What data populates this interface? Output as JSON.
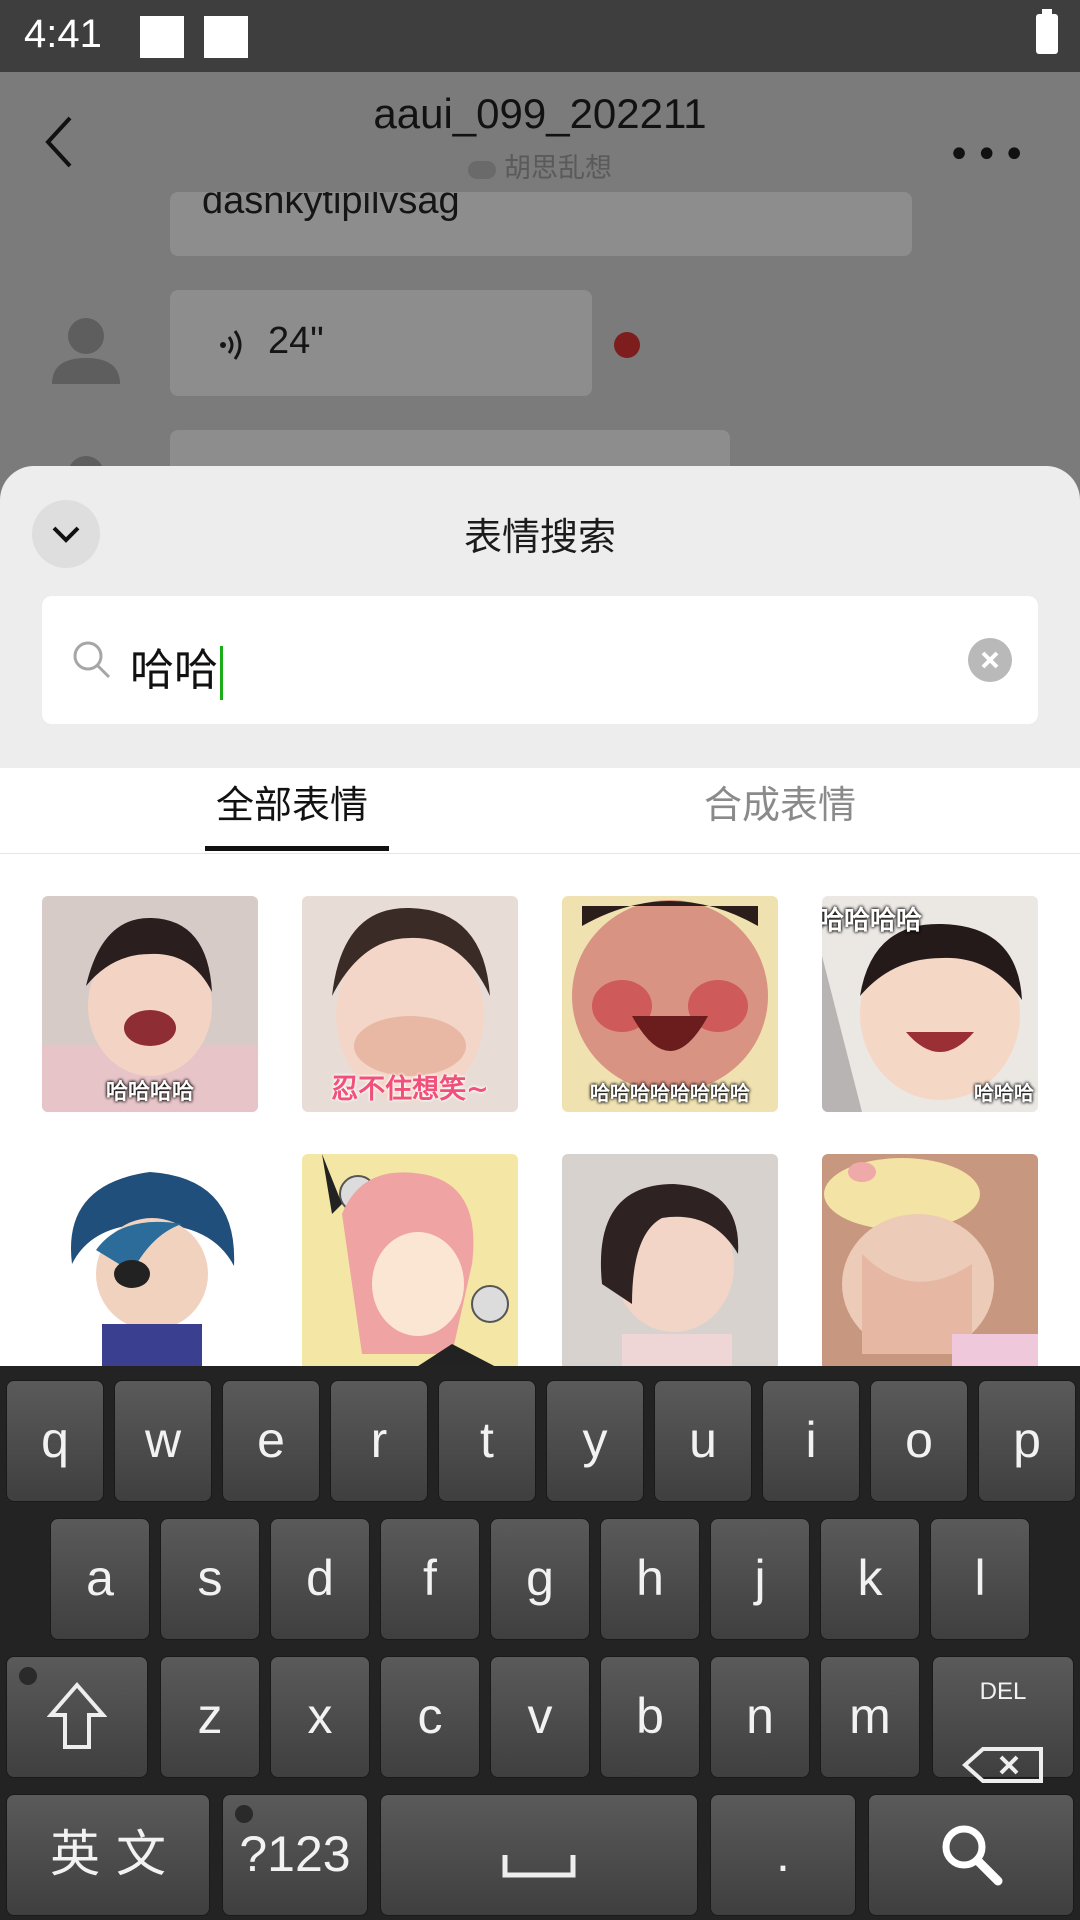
{
  "status": {
    "time": "4:41"
  },
  "chat": {
    "title": "aaui_099_202211",
    "subtitle": "胡思乱想",
    "message_partial": "dasnkytipilvsag",
    "voice_duration": "24\""
  },
  "sheet": {
    "title": "表情搜索",
    "search_value": "哈哈",
    "tabs": [
      {
        "label": "全部表情"
      },
      {
        "label": "合成表情"
      }
    ]
  },
  "stickers": [
    {
      "caption": "哈哈哈哈",
      "bg": "#d8c8c0"
    },
    {
      "caption": "忍不住想笑~",
      "bg": "#efe4dd"
    },
    {
      "caption": "哈哈哈哈哈哈哈哈",
      "bg": "#d69080"
    },
    {
      "caption": "哈哈哈哈",
      "caption2": "哈哈哈",
      "bg": "#e9e6e2"
    },
    {
      "caption": "",
      "bg": "#ffffff"
    },
    {
      "caption": "",
      "bg": "#f3e7a0"
    },
    {
      "caption": "",
      "bg": "#cfcac8"
    },
    {
      "caption": "",
      "bg": "#c99a86"
    }
  ],
  "keyboard": {
    "row1": [
      "q",
      "w",
      "e",
      "r",
      "t",
      "y",
      "u",
      "i",
      "o",
      "p"
    ],
    "row2": [
      "a",
      "s",
      "d",
      "f",
      "g",
      "h",
      "j",
      "k",
      "l"
    ],
    "row3": [
      "z",
      "x",
      "c",
      "v",
      "b",
      "n",
      "m"
    ],
    "lang_key": "英 文",
    "sym_key": "?123",
    "del_key": "DEL",
    "period_key": "."
  },
  "colors": {
    "accent_caret": "#1aad19",
    "keyboard_bg": "#232323"
  }
}
